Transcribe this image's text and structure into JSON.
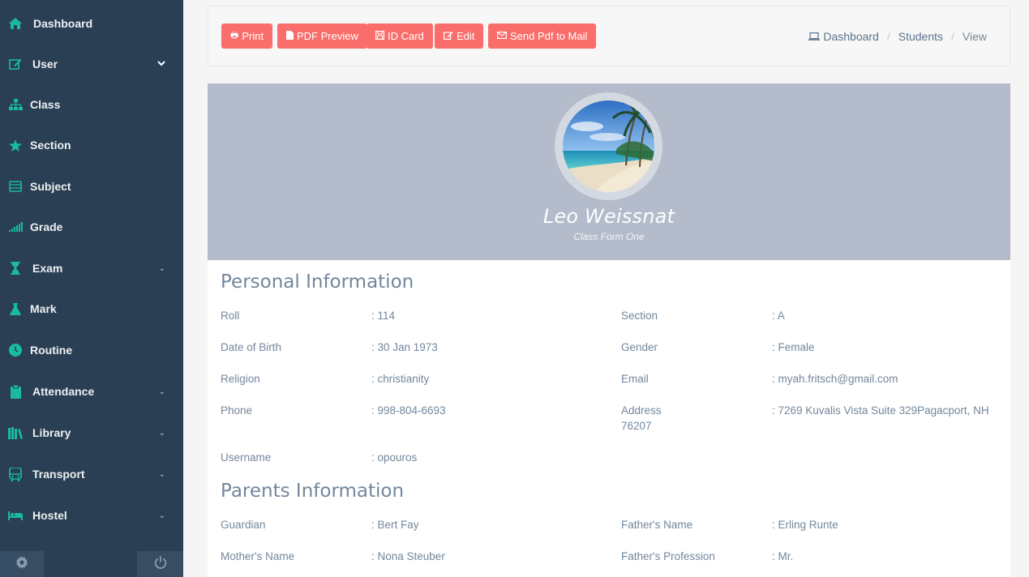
{
  "sidebar": {
    "items": [
      {
        "label": "Dashboard",
        "icon": "home-icon",
        "has_submenu": false
      },
      {
        "label": "User",
        "icon": "edit-icon",
        "has_submenu": true
      },
      {
        "label": "Class",
        "icon": "sitemap-icon",
        "has_submenu": false
      },
      {
        "label": "Section",
        "icon": "star-icon",
        "has_submenu": false
      },
      {
        "label": "Subject",
        "icon": "book-icon",
        "has_submenu": false
      },
      {
        "label": "Grade",
        "icon": "signal-icon",
        "has_submenu": false
      },
      {
        "label": "Exam",
        "icon": "hourglass-icon",
        "has_submenu": true
      },
      {
        "label": "Mark",
        "icon": "flask-icon",
        "has_submenu": false
      },
      {
        "label": "Routine",
        "icon": "clock-icon",
        "has_submenu": false
      },
      {
        "label": "Attendance",
        "icon": "clipboard-icon",
        "has_submenu": true
      },
      {
        "label": "Library",
        "icon": "library-icon",
        "has_submenu": true
      },
      {
        "label": "Transport",
        "icon": "bus-icon",
        "has_submenu": true
      },
      {
        "label": "Hostel",
        "icon": "bed-icon",
        "has_submenu": true
      }
    ],
    "footer": {
      "settings_icon": "gear-icon",
      "logout_icon": "power-icon"
    }
  },
  "toolbar": {
    "print": "Print",
    "pdf_preview": "PDF Preview",
    "id_card": "ID Card",
    "edit": "Edit",
    "send_pdf": "Send Pdf to Mail"
  },
  "breadcrumb": {
    "dashboard": "Dashboard",
    "students": "Students",
    "current": "View"
  },
  "profile": {
    "name": "Leo Weissnat",
    "class_line": "Class Form One"
  },
  "personal": {
    "title": "Personal Information",
    "roll_label": "Roll",
    "roll_value": ": 114",
    "section_label": "Section",
    "section_value": ": A",
    "dob_label": "Date of Birth",
    "dob_value": ": 30 Jan 1973",
    "gender_label": "Gender",
    "gender_value": ": Female",
    "religion_label": "Religion",
    "religion_value": ": christianity",
    "email_label": "Email",
    "email_value": ": myah.fritsch@gmail.com",
    "phone_label": "Phone",
    "phone_value": ": 998-804-6693",
    "address_label": "Address",
    "address_value": ": 7269 Kuvalis Vista Suite 329Pagacport, NH",
    "address_cont": "76207",
    "username_label": "Username",
    "username_value": ": opouros"
  },
  "parents": {
    "title": "Parents Information",
    "guardian_label": "Guardian",
    "guardian_value": ": Bert Fay",
    "father_name_label": "Father's Name",
    "father_name_value": ": Erling Runte",
    "mother_name_label": "Mother's Name",
    "mother_name_value": ": Nona Steuber",
    "father_prof_label": "Father's Profession",
    "father_prof_value": ": Mr."
  },
  "colors": {
    "sidebar_bg": "#2a3f54",
    "accent": "#1abb9c",
    "button_bg": "#f96e6a",
    "banner_bg": "#b4bbca"
  }
}
